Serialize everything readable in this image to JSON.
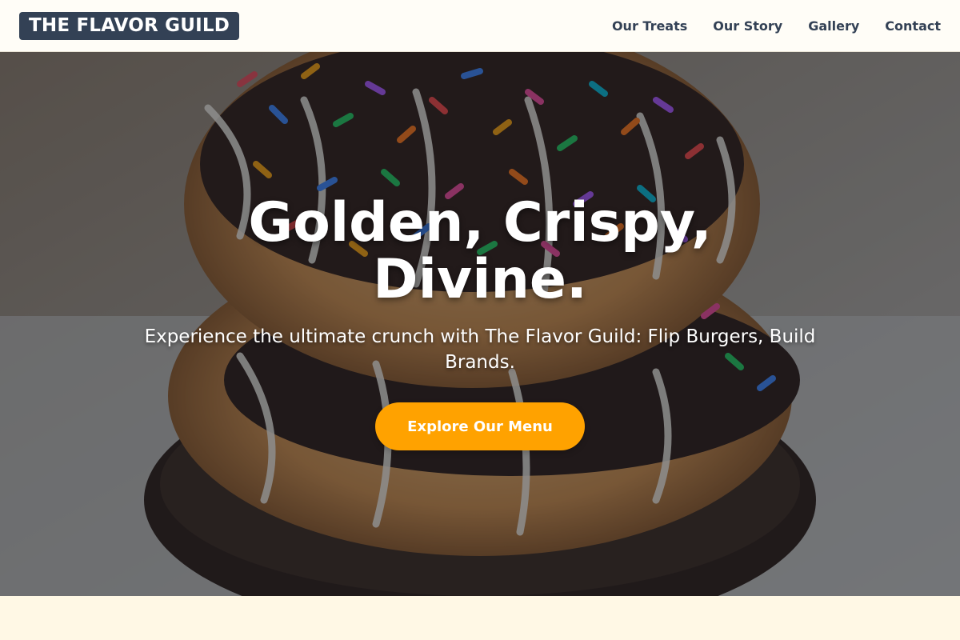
{
  "nav": {
    "logo": "THE FLAVOR GUILD",
    "links": [
      "Our Treats",
      "Our Story",
      "Gallery",
      "Contact"
    ]
  },
  "hero": {
    "title": "Golden, Crispy, Divine.",
    "subtitle": "Experience the ultimate crunch with The Flavor Guild: Flip Burgers, Build Brands.",
    "cta_label": "Explore Our Menu",
    "background_image": "stacked donuts with chocolate drizzle and rainbow sprinkles"
  },
  "colors": {
    "brand_dark": "#334155",
    "accent": "#ffa200",
    "page_bg": "#fff9e6"
  }
}
